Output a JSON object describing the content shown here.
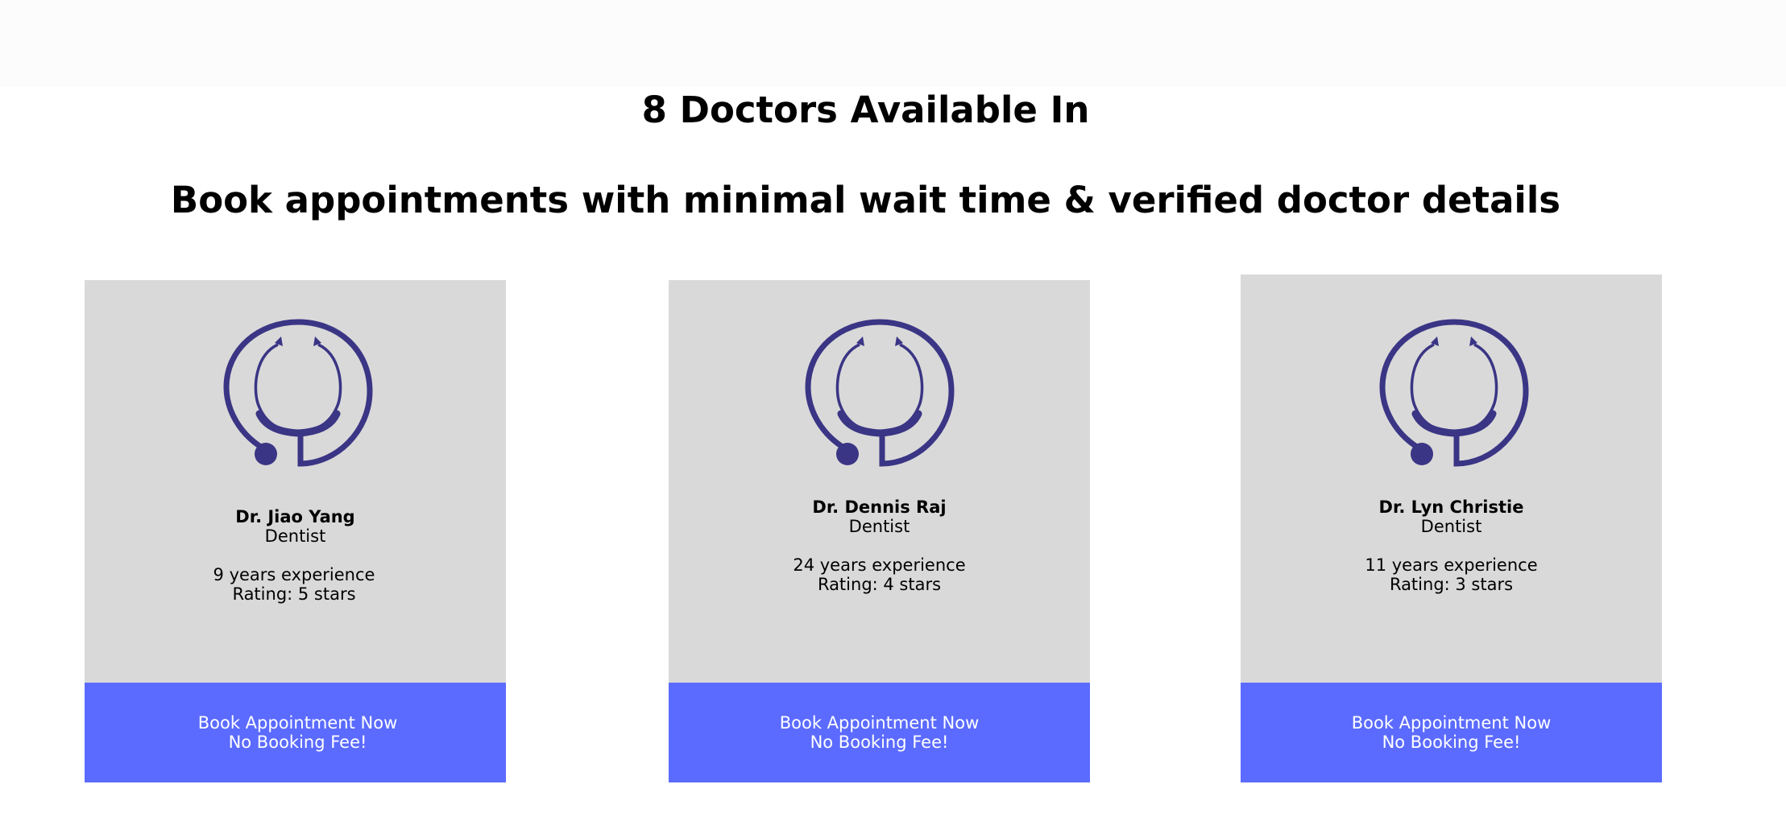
{
  "header": {
    "title": "8 Doctors Available In",
    "subtitle": "Book appointments with minimal wait time & verified doctor details"
  },
  "colors": {
    "card_bg": "#d9d9d9",
    "button_bg": "#5b6bff",
    "icon": "#3a3584"
  },
  "doctors": [
    {
      "name": "Dr. Jiao Yang",
      "specialty": "Dentist",
      "experience": "9 years experience",
      "rating": "Rating: 5 stars",
      "icon": "stethoscope-icon",
      "button_line1": "Book Appointment Now",
      "button_line2": "No Booking Fee!"
    },
    {
      "name": "Dr. Dennis Raj",
      "specialty": "Dentist",
      "experience": "24 years experience",
      "rating": "Rating: 4 stars",
      "icon": "stethoscope-icon",
      "button_line1": "Book Appointment Now",
      "button_line2": "No Booking Fee!"
    },
    {
      "name": "Dr. Lyn Christie",
      "specialty": "Dentist",
      "experience": "11 years experience",
      "rating": "Rating: 3 stars",
      "icon": "stethoscope-icon",
      "button_line1": "Book Appointment Now",
      "button_line2": "No Booking Fee!"
    }
  ]
}
